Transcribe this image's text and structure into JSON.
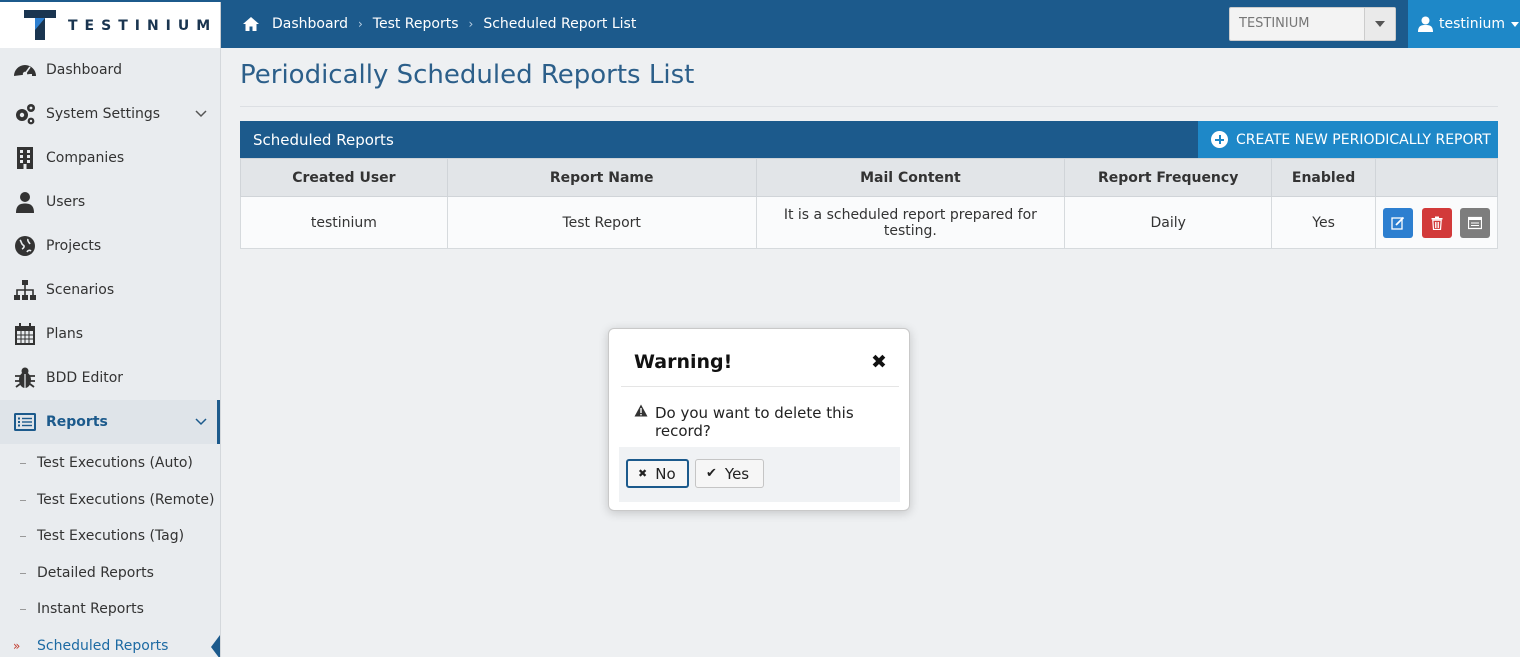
{
  "brand": {
    "name": "TESTINIUM"
  },
  "breadcrumb": [
    "Dashboard",
    "Test Reports",
    "Scheduled Report List"
  ],
  "company_selector": {
    "value": "TESTINIUM"
  },
  "user_menu": {
    "label": "testinium"
  },
  "sidebar": {
    "items": [
      {
        "label": "Dashboard",
        "icon": "dashboard-icon"
      },
      {
        "label": "System Settings",
        "icon": "gears-icon",
        "expandable": true
      },
      {
        "label": "Companies",
        "icon": "building-icon"
      },
      {
        "label": "Users",
        "icon": "user-icon"
      },
      {
        "label": "Projects",
        "icon": "globe-icon"
      },
      {
        "label": "Scenarios",
        "icon": "sitemap-icon"
      },
      {
        "label": "Plans",
        "icon": "calendar-icon"
      },
      {
        "label": "BDD Editor",
        "icon": "bug-icon"
      },
      {
        "label": "Reports",
        "icon": "list-icon",
        "expandable": true,
        "active": true
      }
    ],
    "sub_items": [
      {
        "label": "Test Executions (Auto)"
      },
      {
        "label": "Test Executions (Remote)"
      },
      {
        "label": "Test Executions (Tag)"
      },
      {
        "label": "Detailed Reports"
      },
      {
        "label": "Instant Reports"
      },
      {
        "label": "Scheduled Reports",
        "current": true
      }
    ]
  },
  "main": {
    "title": "Periodically Scheduled Reports List",
    "panel_title": "Scheduled Reports",
    "create_button": "CREATE NEW PERIODICALLY REPORT",
    "table": {
      "columns": [
        "Created User",
        "Report Name",
        "Mail Content",
        "Report Frequency",
        "Enabled",
        ""
      ],
      "rows": [
        [
          "testinium",
          "Test Report",
          "It is a scheduled report prepared for testing.",
          "Daily",
          "Yes"
        ]
      ]
    }
  },
  "modal": {
    "title": "Warning!",
    "message": "Do you want to delete this record?",
    "no_label": "No",
    "yes_label": "Yes"
  },
  "colors": {
    "primary": "#1c5a8c",
    "accent": "#1e88c8",
    "danger": "#d23a3a"
  }
}
